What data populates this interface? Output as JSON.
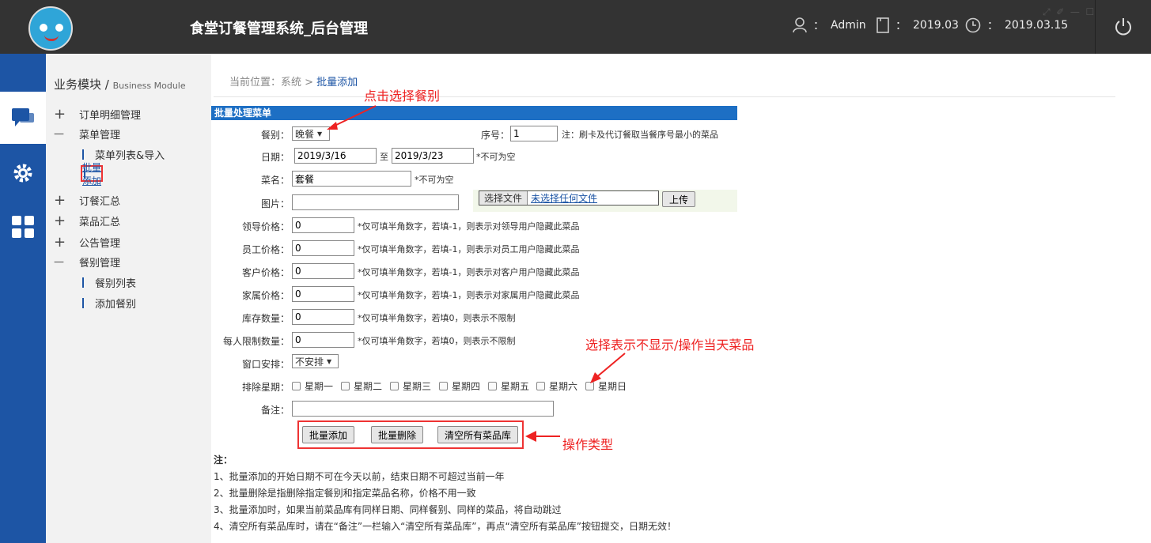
{
  "header": {
    "title": "食堂订餐管理系统_后台管理",
    "user": "Admin",
    "period": "2019.03",
    "date": "2019.03.15",
    "separator": "："
  },
  "sidebar": {
    "title": "业务模块 /",
    "title_en": "Business Module",
    "items": [
      {
        "sym": "+",
        "label": "订单明细管理"
      },
      {
        "sym": "—",
        "label": "菜单管理"
      },
      {
        "sym": "+",
        "label": "订餐汇总"
      },
      {
        "sym": "+",
        "label": "菜品汇总"
      },
      {
        "sym": "+",
        "label": "公告管理"
      },
      {
        "sym": "—",
        "label": "餐别管理"
      }
    ],
    "sub_menu": [
      "菜单列表&导入",
      "批量添加"
    ],
    "sub_meal": [
      "餐别列表",
      "添加餐别"
    ]
  },
  "breadcrumb": {
    "prefix": "当前位置：系统 >",
    "current": "批量添加"
  },
  "panel": {
    "title": "批量处理菜单"
  },
  "form": {
    "meal_label": "餐别：",
    "meal_value": "晚餐",
    "seq_label": "序号：",
    "seq_value": "1",
    "seq_note": "注：刷卡及代订餐取当餐序号最小的菜品",
    "date_label": "日期：",
    "date_from": "2019/3/16",
    "date_to_label": "至",
    "date_to": "2019/3/23",
    "date_note": "*不可为空",
    "name_label": "菜名：",
    "name_value": "套餐",
    "name_note": "*不可为空",
    "image_label": "图片：",
    "file_button": "选择文件",
    "file_status": "未选择任何文件",
    "upload_button": "上传",
    "leader_label": "领导价格：",
    "leader_value": "0",
    "leader_note": "*仅可填半角数字，若填-1，则表示对领导用户隐藏此菜品",
    "staff_label": "员工价格：",
    "staff_value": "0",
    "staff_note": "*仅可填半角数字，若填-1，则表示对员工用户隐藏此菜品",
    "customer_label": "客户价格：",
    "customer_value": "0",
    "customer_note": "*仅可填半角数字，若填-1，则表示对客户用户隐藏此菜品",
    "family_label": "家属价格：",
    "family_value": "0",
    "family_note": "*仅可填半角数字，若填-1，则表示对家属用户隐藏此菜品",
    "stock_label": "库存数量：",
    "stock_value": "0",
    "stock_note": "*仅可填半角数字，若填0，则表示不限制",
    "limit_label": "每人限制数量：",
    "limit_value": "0",
    "limit_note": "*仅可填半角数字，若填0，则表示不限制",
    "window_label": "窗口安排：",
    "window_value": "不安排",
    "exclude_label": "排除星期：",
    "weekdays": [
      "星期一",
      "星期二",
      "星期三",
      "星期四",
      "星期五",
      "星期六",
      "星期日"
    ],
    "remark_label": "备注："
  },
  "actions": {
    "batch_add": "批量添加",
    "batch_delete": "批量删除",
    "clear_all": "清空所有菜品库"
  },
  "annotations": {
    "meal": "点击选择餐别",
    "weekday": "选择表示不显示/操作当天菜品",
    "action": "操作类型"
  },
  "notes": {
    "title": "注：",
    "lines": [
      "1、批量添加的开始日期不可在今天以前，结束日期不可超过当前一年",
      "2、批量删除是指删除指定餐别和指定菜品名称，价格不用一致",
      "3、批量添加时，如果当前菜品库有同样日期、同样餐别、同样的菜品，将自动跳过",
      "4、清空所有菜品库时，请在“备注”一栏输入“清空所有菜品库”，再点“清空所有菜品库”按钮提交，日期无效！"
    ]
  },
  "colors": {
    "topbar": "#333333",
    "leftbar": "#1d55a5",
    "panel_head": "#1d6fc4",
    "annotation": "#ee2222"
  }
}
